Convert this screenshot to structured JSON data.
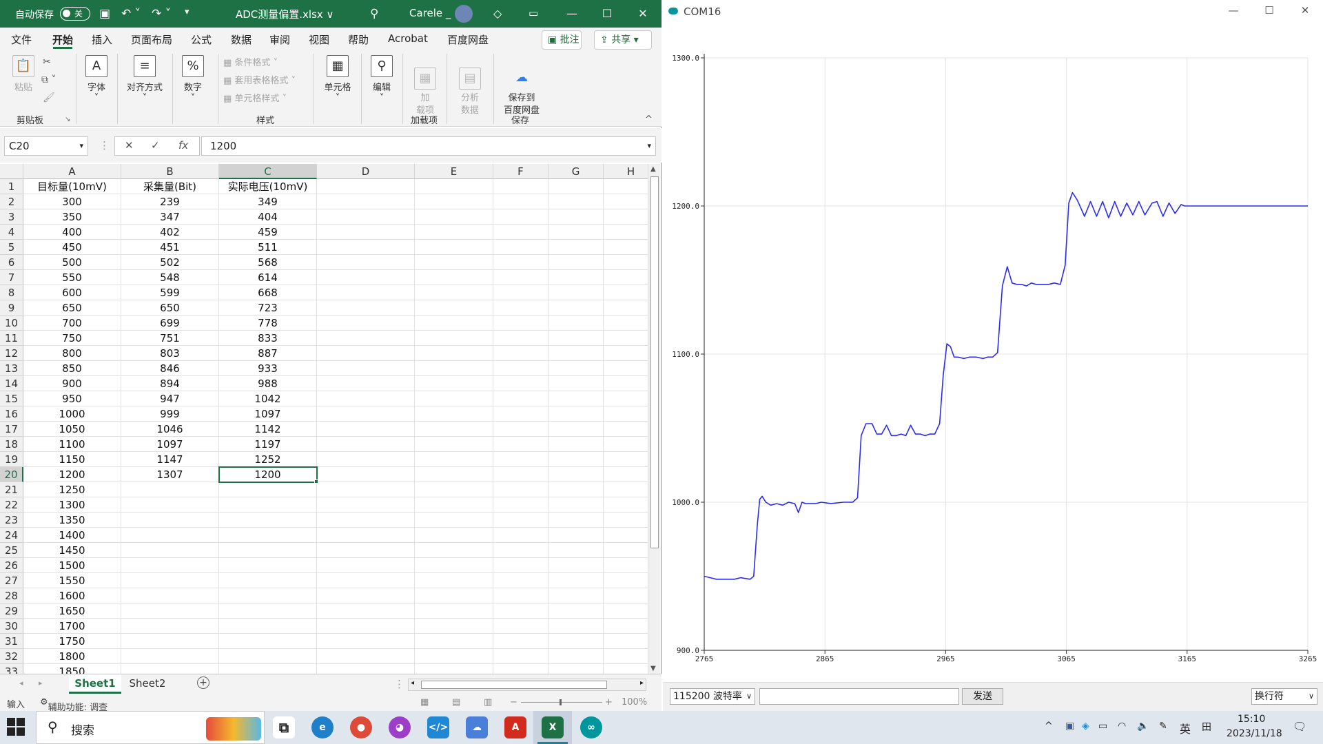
{
  "excel": {
    "title_bar": {
      "autosave_label": "自动保存",
      "autosave_state": "关",
      "file_title": "ADC测量偏置.xlsx ∨",
      "user": "Carele _"
    },
    "menu": [
      "文件",
      "开始",
      "插入",
      "页面布局",
      "公式",
      "数据",
      "审阅",
      "视图",
      "帮助",
      "Acrobat",
      "百度网盘"
    ],
    "active_menu": "开始",
    "comment_button": "批注",
    "share_button": "共享",
    "ribbon": {
      "paste": "粘贴",
      "font": "字体",
      "align": "对齐方式",
      "number": "数字",
      "cond_format": "条件格式",
      "table_format": "套用表格格式",
      "cell_style": "单元格样式",
      "cells": "单元格",
      "edit": "编辑",
      "addin": "加\n载项",
      "analyze": "分析\n数据",
      "save_baidu": "保存到\n百度网盘",
      "groups": {
        "clipboard": "剪贴板",
        "styles": "样式",
        "addins": "加载项",
        "save": "保存"
      }
    },
    "name_box": "C20",
    "formula_value": "1200",
    "columns": [
      "A",
      "B",
      "C",
      "D",
      "E",
      "F",
      "G",
      "H"
    ],
    "selected_column": "C",
    "selected_row": 20,
    "rows": [
      [
        "目标量(10mV)",
        "采集量(Bit)",
        "实际电压(10mV)"
      ],
      [
        "300",
        "239",
        "349"
      ],
      [
        "350",
        "347",
        "404"
      ],
      [
        "400",
        "402",
        "459"
      ],
      [
        "450",
        "451",
        "511"
      ],
      [
        "500",
        "502",
        "568"
      ],
      [
        "550",
        "548",
        "614"
      ],
      [
        "600",
        "599",
        "668"
      ],
      [
        "650",
        "650",
        "723"
      ],
      [
        "700",
        "699",
        "778"
      ],
      [
        "750",
        "751",
        "833"
      ],
      [
        "800",
        "803",
        "887"
      ],
      [
        "850",
        "846",
        "933"
      ],
      [
        "900",
        "894",
        "988"
      ],
      [
        "950",
        "947",
        "1042"
      ],
      [
        "1000",
        "999",
        "1097"
      ],
      [
        "1050",
        "1046",
        "1142"
      ],
      [
        "1100",
        "1097",
        "1197"
      ],
      [
        "1150",
        "1147",
        "1252"
      ],
      [
        "1200",
        "1307",
        "1200"
      ],
      [
        "1250",
        "",
        ""
      ],
      [
        "1300",
        "",
        ""
      ],
      [
        "1350",
        "",
        ""
      ],
      [
        "1400",
        "",
        ""
      ],
      [
        "1450",
        "",
        ""
      ],
      [
        "1500",
        "",
        ""
      ],
      [
        "1550",
        "",
        ""
      ],
      [
        "1600",
        "",
        ""
      ],
      [
        "1650",
        "",
        ""
      ],
      [
        "1700",
        "",
        ""
      ],
      [
        "1750",
        "",
        ""
      ],
      [
        "1800",
        "",
        ""
      ],
      [
        "1850",
        "",
        ""
      ]
    ],
    "sheets": [
      "Sheet1",
      "Sheet2"
    ],
    "active_sheet": "Sheet1",
    "status": {
      "mode": "输入",
      "accessibility": "辅助功能: 调查",
      "zoom": "100%"
    }
  },
  "plotter": {
    "title": "COM16",
    "baud": "115200 波特率",
    "send": "发送",
    "line_ending": "换行符",
    "line_color": "#2b2bf0"
  },
  "chart_data": {
    "type": "line",
    "title": "",
    "xlabel": "",
    "ylabel": "",
    "xlim": [
      2765,
      3265
    ],
    "ylim": [
      900,
      1300
    ],
    "x_ticks": [
      "2765",
      "2865",
      "2965",
      "3065",
      "3165",
      "3265"
    ],
    "y_ticks": [
      "900.0",
      "1000.0",
      "1100.0",
      "1200.0",
      "1300.0"
    ],
    "grid": true,
    "series": [
      {
        "x": [
          2765,
          2770,
          2775,
          2780,
          2790,
          2795,
          2803,
          2806,
          2809,
          2811,
          2813,
          2816,
          2820,
          2825,
          2830,
          2835,
          2840,
          2843,
          2846,
          2849,
          2852,
          2857,
          2862,
          2870,
          2880,
          2888,
          2892,
          2895,
          2899,
          2904,
          2908,
          2912,
          2916,
          2920,
          2924,
          2928,
          2932,
          2936,
          2940,
          2944,
          2948,
          2952,
          2956,
          2960,
          2963,
          2966,
          2969,
          2972,
          2975,
          2980,
          2985,
          2990,
          2996,
          3000,
          3004,
          3008,
          3012,
          3016,
          3020,
          3024,
          3028,
          3032,
          3036,
          3040,
          3045,
          3050,
          3055,
          3060,
          3064,
          3067,
          3070,
          3074,
          3080,
          3085,
          3090,
          3095,
          3100,
          3105,
          3110,
          3115,
          3120,
          3125,
          3130,
          3136,
          3140,
          3145,
          3150,
          3155,
          3160,
          3163,
          3166,
          3169,
          3173,
          3177,
          3181,
          3185,
          3189,
          3193,
          3197,
          3201,
          3205,
          3209,
          3213,
          3217,
          3221,
          3225,
          3229,
          3233,
          3237,
          3241,
          3245,
          3249,
          3253,
          3257,
          3261,
          3265
        ],
        "y": [
          950,
          949,
          948,
          948,
          948,
          949,
          948,
          950,
          985,
          1002,
          1004,
          1000,
          998,
          999,
          998,
          1000,
          999,
          993,
          1000,
          999,
          999,
          999,
          1000,
          999,
          1000,
          1000,
          1003,
          1045,
          1053,
          1053,
          1046,
          1046,
          1052,
          1045,
          1045,
          1046,
          1045,
          1052,
          1046,
          1046,
          1045,
          1046,
          1046,
          1053,
          1086,
          1107,
          1105,
          1098,
          1098,
          1097,
          1098,
          1098,
          1097,
          1098,
          1098,
          1101,
          1146,
          1159,
          1148,
          1147,
          1147,
          1146,
          1148,
          1147,
          1147,
          1147,
          1148,
          1147,
          1160,
          1202,
          1209,
          1204,
          1193,
          1203,
          1193,
          1203,
          1192,
          1203,
          1193,
          1202,
          1194,
          1203,
          1194,
          1202,
          1203,
          1193,
          1202,
          1195,
          1201,
          1200,
          1200,
          1200,
          1200,
          1200,
          1200,
          1200,
          1200,
          1200,
          1200,
          1200,
          1200,
          1200,
          1200,
          1200,
          1200,
          1200,
          1200,
          1200,
          1200,
          1200,
          1200,
          1200,
          1200,
          1200,
          1200,
          1200
        ]
      }
    ]
  },
  "taskbar": {
    "search": "搜索",
    "time": "15:10",
    "date": "2023/11/18",
    "ime": "英"
  }
}
